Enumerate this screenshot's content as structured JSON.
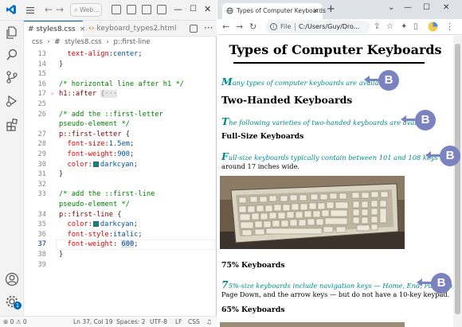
{
  "vscode": {
    "search_placeholder": "Web...",
    "tabs": [
      {
        "label": "styles8.css",
        "close": "×",
        "active": true
      },
      {
        "label": "keyboard_types2.html",
        "active": false
      }
    ],
    "breadcrumb": [
      "css",
      "›",
      "#",
      "styles8.css",
      "›",
      "p::first-line"
    ],
    "status": {
      "problems": "⊗ 0 ⚠ 0",
      "position": "Ln 37, Col 19",
      "spaces": "Spaces: 2",
      "encoding": "UTF-8",
      "eol": "LF",
      "language": "CSS"
    },
    "account_badge": "1",
    "code": {
      "l13": {
        "num": "13",
        "prop": "text-align",
        "val": "center"
      },
      "l14": {
        "num": "14"
      },
      "l15": {
        "num": "15"
      },
      "l16": {
        "num": "16",
        "comment": "/* horizontal line after h1 */"
      },
      "l17": {
        "num": "17",
        "selector": "h1::after",
        "folded": "{···"
      },
      "l25": {
        "num": "25"
      },
      "l26": {
        "num": "26",
        "comment": "/* add the ::first-letter"
      },
      "l26b": {
        "comment": "pseudo-element */"
      },
      "l27": {
        "num": "27",
        "selector": "p::first-letter"
      },
      "l28": {
        "num": "28",
        "prop": "font-size",
        "val": "1.5em"
      },
      "l29": {
        "num": "29",
        "prop": "font-weight",
        "val": "900"
      },
      "l30": {
        "num": "30",
        "prop": "color",
        "val": "darkcyan"
      },
      "l31": {
        "num": "31"
      },
      "l32": {
        "num": "32"
      },
      "l33": {
        "num": "33",
        "comment": "/* add the ::first-line"
      },
      "l33b": {
        "comment": "pseudo-element */"
      },
      "l34": {
        "num": "34",
        "selector": "p::first-line"
      },
      "l35": {
        "num": "35",
        "prop": "color",
        "val": "darkcyan"
      },
      "l36": {
        "num": "36",
        "prop": "font-style",
        "val": "italic"
      },
      "l37": {
        "num": "37",
        "prop": "font-weight",
        "val": "600"
      },
      "l38": {
        "num": "38"
      },
      "l39": {
        "num": "39"
      }
    }
  },
  "browser": {
    "tab_title": "Types of Computer Keyboards",
    "tab_close": "×",
    "new_tab": "+",
    "window_controls": [
      "⌄",
      "—",
      "☐",
      "✕"
    ],
    "address": {
      "scheme": "File",
      "url": "C:/Users/Guy/Dro..."
    },
    "page": {
      "h1": "Types of Computer Keyboards",
      "p1": {
        "first": "M",
        "rest": "any types of computer keyboards are available."
      },
      "h2a": "Two-Handed Keyboards",
      "p2": {
        "first": "T",
        "rest": "he following varieties of two-handed keyboards are available."
      },
      "h3a": "Full-Size Keyboards",
      "p3": {
        "first": "F",
        "rest": "ull-size keyboards typically contain between 101 and 108 keys and are",
        "line2": "around 17 inches wide."
      },
      "h3b": "75% Keyboards",
      "p4": {
        "first": "7",
        "rest": "5%-size keyboards include navigation keys — Home, End, Page Up,",
        "line2": "Page Down, and the arrow keys — but do not have a 10-key keypad."
      },
      "h3c": "65% Keyboards"
    },
    "callout_label": "B"
  },
  "colors": {
    "accent": "#008b8b",
    "callout": "#7b82c0",
    "vscode_blue": "#005fb8"
  }
}
